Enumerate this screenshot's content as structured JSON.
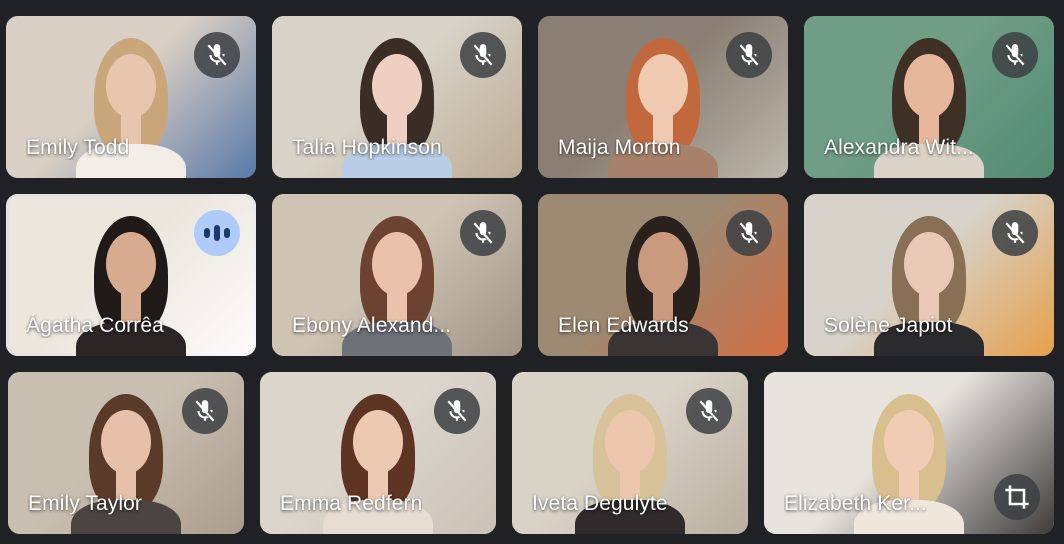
{
  "participants": [
    {
      "name": "Emily Todd",
      "muted": true,
      "bg": "#d9cfc4",
      "accent": "#4a6fa5",
      "hair": "#c9a77a",
      "skin": "#e8c6ad",
      "shirt": "#f2ede6"
    },
    {
      "name": "Talia Hopkinson",
      "muted": true,
      "bg": "#d8d2c8",
      "accent": "#b9a88e",
      "hair": "#3a2d26",
      "skin": "#efcfbf",
      "shirt": "#b9cde6"
    },
    {
      "name": "Maija Morton",
      "muted": true,
      "bg": "#8b7f73",
      "accent": "#c2bdb3",
      "hair": "#c2683d",
      "skin": "#efc9b0",
      "shirt": "#a8816a"
    },
    {
      "name": "Alexandra Wit...",
      "muted": true,
      "bg": "#6f9d86",
      "accent": "#4f8a70",
      "hair": "#3f3026",
      "skin": "#e6b79b",
      "shirt": "#dcd3c8"
    },
    {
      "name": "Ágatha Corrêa",
      "muted": false,
      "speaking": true,
      "bg": "#ece6dd",
      "accent": "#ffffff",
      "hair": "#1f1a17",
      "skin": "#d7ab90",
      "shirt": "#2b2625"
    },
    {
      "name": "Ebony Alexand...",
      "muted": true,
      "bg": "#cfc4b4",
      "accent": "#9a8e80",
      "hair": "#6b4330",
      "skin": "#e8c2aa",
      "shirt": "#6d7178"
    },
    {
      "name": "Elen Edwards",
      "muted": true,
      "bg": "#9d8a72",
      "accent": "#d96a3d",
      "hair": "#2a211c",
      "skin": "#c99a7d",
      "shirt": "#3a3434"
    },
    {
      "name": "Solène Japiot",
      "muted": true,
      "bg": "#d7d3cb",
      "accent": "#e89a3c",
      "hair": "#8a6f57",
      "skin": "#e9c9b5",
      "shirt": "#2b2a2c"
    },
    {
      "name": "Emily Taylor",
      "muted": true,
      "bg": "#c9bfb0",
      "accent": "#a7998a",
      "hair": "#5a3a28",
      "skin": "#e6c0a8",
      "shirt": "#4c4440"
    },
    {
      "name": "Emma Redfern",
      "muted": true,
      "bg": "#dbd5cc",
      "accent": "#c8c0b5",
      "hair": "#5e3423",
      "skin": "#eec9b2",
      "shirt": "#e7ddd3"
    },
    {
      "name": "Iveta Degulyte",
      "muted": true,
      "bg": "#d9d2c6",
      "accent": "#b6ab9c",
      "hair": "#d7c29a",
      "skin": "#ecc7ae",
      "shirt": "#2f2b2d"
    },
    {
      "name": "Elizabeth Ker...",
      "muted": false,
      "self": true,
      "bg": "#e7e3dd",
      "accent": "#2a2a2a",
      "hair": "#d9bf8d",
      "skin": "#f0ccb5",
      "shirt": "#efe6dc"
    }
  ],
  "icons": {
    "muted": "mic-off-icon",
    "speaking": "audio-level-icon",
    "reframe": "crop-icon"
  },
  "colors": {
    "background": "#202124",
    "active_outline": "#aecbfa",
    "control_bg": "#3c4043"
  }
}
